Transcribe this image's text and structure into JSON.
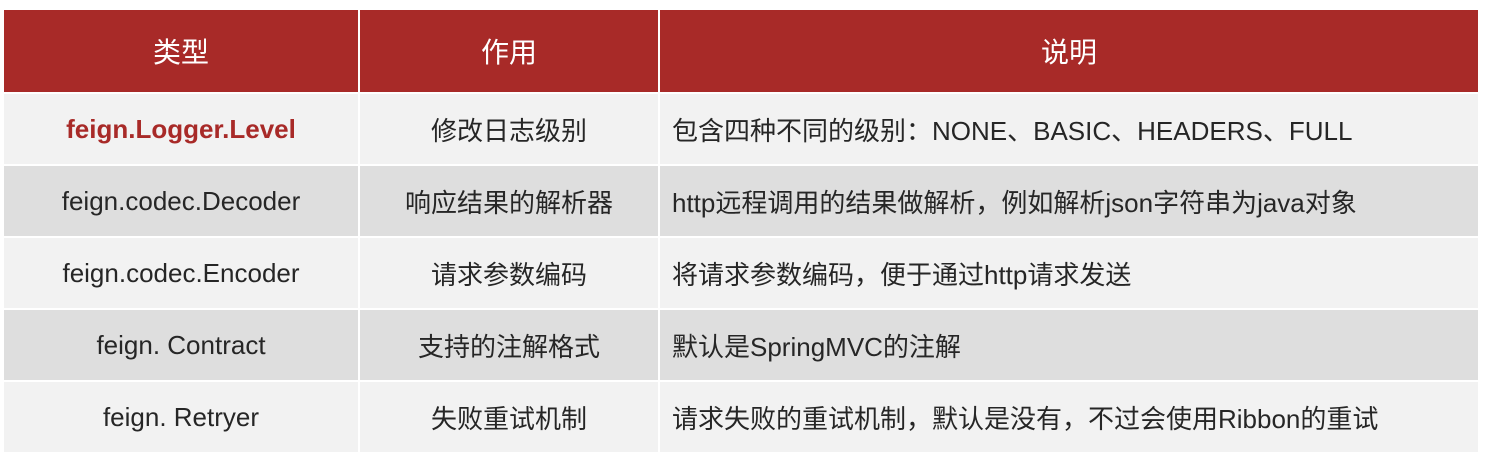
{
  "header": [
    "类型",
    "作用",
    "说明"
  ],
  "accent_color": "#a82a28",
  "rows": [
    {
      "type": "feign.Logger.Level",
      "purpose": "修改日志级别",
      "description": "包含四种不同的级别：NONE、BASIC、HEADERS、FULL",
      "highlighted": true
    },
    {
      "type": "feign.codec.Decoder",
      "purpose": "响应结果的解析器",
      "description": "http远程调用的结果做解析，例如解析json字符串为java对象"
    },
    {
      "type": "feign.codec.Encoder",
      "purpose": "请求参数编码",
      "description": "将请求参数编码，便于通过http请求发送"
    },
    {
      "type": "feign. Contract",
      "purpose": "支持的注解格式",
      "description": "默认是SpringMVC的注解"
    },
    {
      "type": "feign. Retryer",
      "purpose": "失败重试机制",
      "description": "请求失败的重试机制，默认是没有，不过会使用Ribbon的重试"
    }
  ]
}
